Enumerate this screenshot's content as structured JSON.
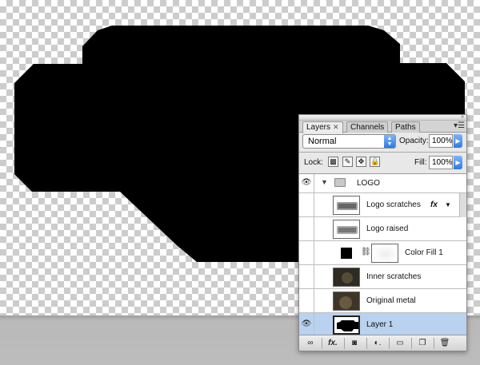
{
  "palette": {
    "tabs": [
      {
        "label": "Layers",
        "active": true,
        "closable": true
      },
      {
        "label": "Channels",
        "active": false
      },
      {
        "label": "Paths",
        "active": false
      }
    ],
    "blend_mode": "Normal",
    "opacity_label": "Opacity:",
    "opacity_value": "100%",
    "lock_label": "Lock:",
    "fill_label": "Fill:",
    "fill_value": "100%",
    "lock_icons": [
      "lock-transparent-icon",
      "lock-image-icon",
      "lock-position-icon",
      "lock-all-icon"
    ]
  },
  "layers": [
    {
      "name": "LOGO",
      "type": "group",
      "visible": true,
      "icon": "folder-icon"
    },
    {
      "name": "Logo scratches",
      "type": "layer",
      "visible": false,
      "fx": true,
      "fx_label": "fx"
    },
    {
      "name": "Logo raised",
      "type": "layer",
      "visible": false
    },
    {
      "name": "Color Fill 1",
      "type": "fill",
      "visible": false
    },
    {
      "name": "Inner scratches",
      "type": "layer",
      "visible": false
    },
    {
      "name": "Original metal",
      "type": "layer",
      "visible": false
    },
    {
      "name": "Layer 1",
      "type": "layer",
      "visible": true,
      "selected": true
    }
  ],
  "footer": {
    "icons": [
      "link-layers-icon",
      "fx-icon",
      "mask-icon",
      "adjustment-layer-icon",
      "new-group-icon",
      "new-layer-icon",
      "trash-icon"
    ],
    "fx_label": "fx."
  },
  "colors": {
    "shape": "#000000",
    "selected_row": "#b9d2f0",
    "accent": "#2f79e4"
  }
}
